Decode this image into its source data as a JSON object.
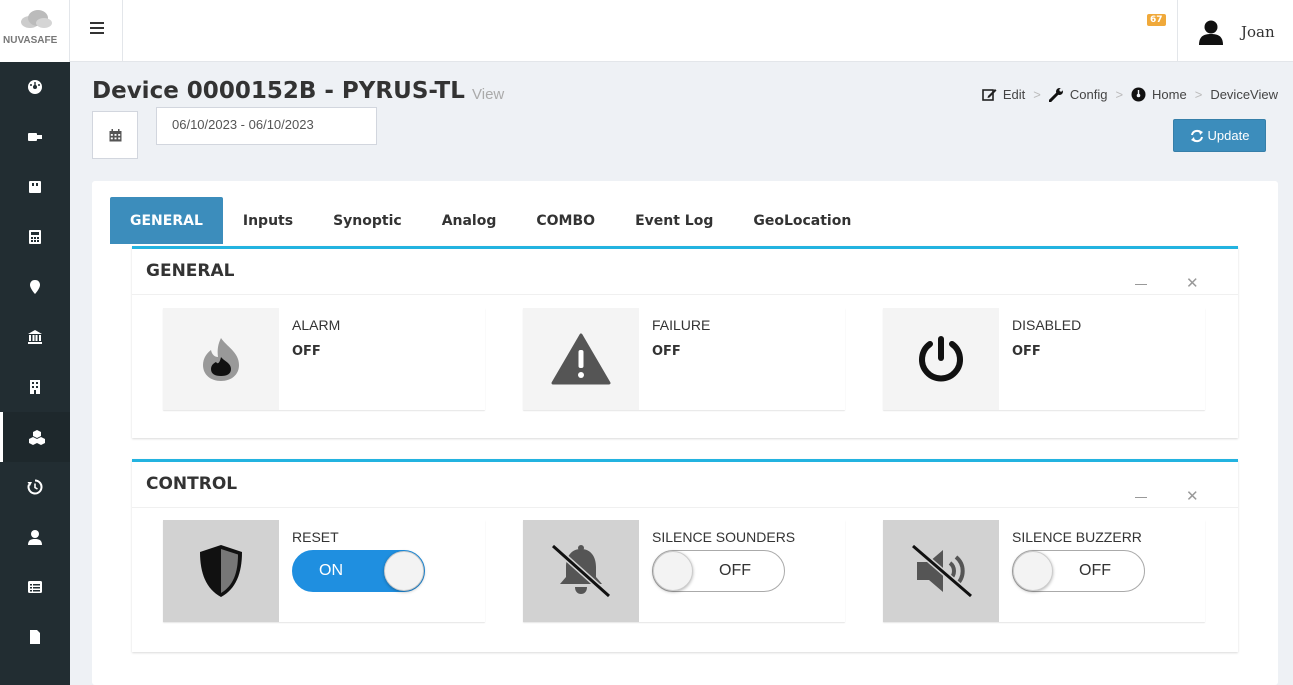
{
  "brand": {
    "logo_text": "NUVASAFE"
  },
  "topbar": {
    "notification_count": "67",
    "user_name": "Joan"
  },
  "page": {
    "title": "Device 0000152B - PYRUS-TL",
    "subtitle": "View",
    "date_range": "06/10/2023 - 06/10/2023",
    "update_label": "Update"
  },
  "breadcrumb": {
    "edit": "Edit",
    "config": "Config",
    "home": "Home",
    "current": "DeviceView",
    "separator": ">"
  },
  "tabs": [
    {
      "label": "GENERAL",
      "active": true
    },
    {
      "label": "Inputs"
    },
    {
      "label": "Synoptic"
    },
    {
      "label": "Analog"
    },
    {
      "label": "COMBO"
    },
    {
      "label": "Event Log"
    },
    {
      "label": "GeoLocation"
    }
  ],
  "general_panel": {
    "title": "GENERAL",
    "items": [
      {
        "label": "ALARM",
        "value": "OFF",
        "icon": "fire-icon"
      },
      {
        "label": "FAILURE",
        "value": "OFF",
        "icon": "warning-icon"
      },
      {
        "label": "DISABLED",
        "value": "OFF",
        "icon": "power-icon"
      }
    ]
  },
  "control_panel": {
    "title": "CONTROL",
    "items": [
      {
        "label": "RESET",
        "state": "ON",
        "icon": "shield-icon"
      },
      {
        "label": "SILENCE SOUNDERS",
        "state": "OFF",
        "icon": "bell-slash-icon"
      },
      {
        "label": "SILENCE BUZZERR",
        "state": "OFF",
        "icon": "volume-mute-icon"
      }
    ]
  },
  "colors": {
    "accent": "#3c8dbc",
    "panel_border": "#23b3e0",
    "sidebar": "#222d32",
    "toggle_on": "#1f8fe0",
    "badge": "#f0a93a"
  }
}
